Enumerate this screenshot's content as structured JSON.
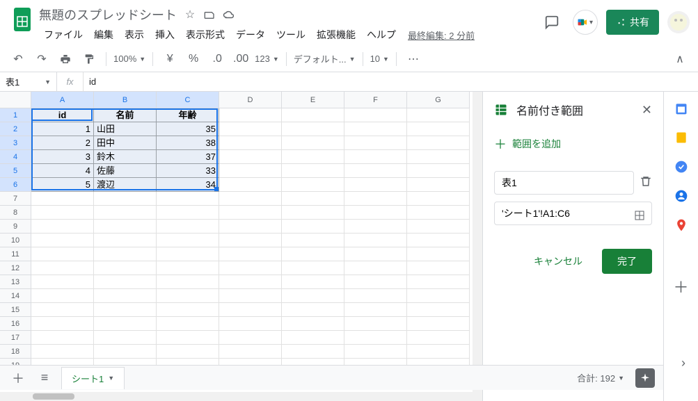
{
  "header": {
    "title": "無題のスプレッドシート",
    "menus": [
      "ファイル",
      "編集",
      "表示",
      "挿入",
      "表示形式",
      "データ",
      "ツール",
      "拡張機能",
      "ヘルプ"
    ],
    "last_edit": "最終編集: 2 分前",
    "share_label": "共有"
  },
  "toolbar": {
    "zoom": "100%",
    "font": "デフォルト...",
    "font_size": "10"
  },
  "formula_bar": {
    "name_box": "表1",
    "fx": "fx",
    "value": "id"
  },
  "grid": {
    "columns": [
      "A",
      "B",
      "C",
      "D",
      "E",
      "F",
      "G"
    ],
    "selected_cols": [
      "A",
      "B",
      "C"
    ],
    "selected_rows": [
      1,
      2,
      3,
      4,
      5,
      6
    ],
    "row_count": 20,
    "headers": [
      "id",
      "名前",
      "年齢"
    ],
    "data": [
      {
        "id": "1",
        "name": "山田",
        "age": "35"
      },
      {
        "id": "2",
        "name": "田中",
        "age": "38"
      },
      {
        "id": "3",
        "name": "鈴木",
        "age": "37"
      },
      {
        "id": "4",
        "name": "佐藤",
        "age": "33"
      },
      {
        "id": "5",
        "name": "渡辺",
        "age": "34"
      }
    ]
  },
  "panel": {
    "title": "名前付き範囲",
    "add_range": "範囲を追加",
    "name_value": "表1",
    "range_value": "'シート1'!A1:C6",
    "cancel": "キャンセル",
    "done": "完了"
  },
  "footer": {
    "sheet_name": "シート1",
    "sum_label": "合計: 192"
  }
}
